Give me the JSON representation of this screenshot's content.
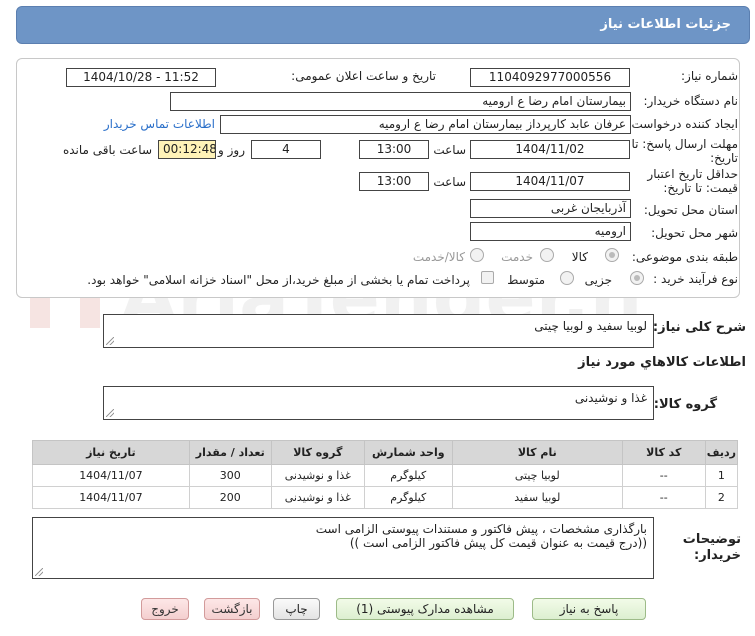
{
  "header": {
    "title": "جزئیات اطلاعات نیاز"
  },
  "form": {
    "need_number_label": "شماره نیاز:",
    "need_number": "1104092977000556",
    "announce_label": "تاریخ و ساعت اعلان عمومی:",
    "announce_value": "1404/10/28 - 11:52",
    "buyer_org_label": "نام دستگاه خریدار:",
    "buyer_org": "بیمارستان امام رضا  ع  ارومیه",
    "requester_label": "ایجاد کننده درخواست:",
    "requester": "عرفان عابد کارپرداز بیمارستان امام رضا  ع  ارومیه",
    "contact_link": "اطلاعات تماس خریدار",
    "deadline_label_1": "مهلت ارسال پاسخ: تا",
    "deadline_label_2": "تاریخ:",
    "deadline_date": "1404/11/02",
    "time_label": "ساعت",
    "deadline_time": "13:00",
    "days_value": "4",
    "days_label": "روز و",
    "remaining_value": "00:12:48",
    "remaining_label": "ساعت باقی مانده",
    "validity_label_1": "حداقل تاریخ اعتبار",
    "validity_label_2": "قیمت: تا تاریخ:",
    "validity_date": "1404/11/07",
    "validity_time": "13:00",
    "province_label": "استان محل تحویل:",
    "province": "آذربایجان غربی",
    "city_label": "شهر محل تحویل:",
    "city": "ارومیه",
    "category_label": "طبقه بندی موضوعی:",
    "category_options": [
      "کالا",
      "خدمت",
      "کالا/خدمت"
    ],
    "process_label": "نوع فرآیند خرید :",
    "process_options": [
      "جزیی",
      "متوسط"
    ],
    "payment_note": "پرداخت تمام یا بخشی از مبلغ خرید،از محل \"اسناد خزانه اسلامی\" خواهد بود."
  },
  "summary": {
    "label": "شرح کلی نیاز:",
    "value": "لوبیا سفید و لوبیا چیتی"
  },
  "goods_info_title": "اطلاعات کالاهاي مورد نیاز",
  "goods_group": {
    "label": "گروه کالا:",
    "value": "غذا و نوشیدنی"
  },
  "table": {
    "headers": [
      "ردیف",
      "کد کالا",
      "نام کالا",
      "واحد شمارش",
      "گروه کالا",
      "تعداد / مقدار",
      "تاریخ نیاز"
    ],
    "rows": [
      [
        "1",
        "--",
        "لوبیا چیتی",
        "کیلوگرم",
        "غذا و نوشیدنی",
        "300",
        "1404/11/07"
      ],
      [
        "2",
        "--",
        "لوبیا سفید",
        "کیلوگرم",
        "غذا و نوشیدنی",
        "200",
        "1404/11/07"
      ]
    ]
  },
  "buyer_notes": {
    "label_1": "توضیحات",
    "label_2": "خریدار:",
    "line_1": "بارگذاری مشخصات ، پیش فاکتور و مستندات پیوستی الزامی است",
    "line_2": "((درج قیمت به عنوان قیمت کل پیش فاکتور الزامی است ))"
  },
  "buttons": {
    "reply": "پاسخ به نیاز",
    "attachments": "مشاهده مدارک پیوستی (1)",
    "print": "چاپ",
    "back": "بازگشت",
    "exit": "خروج"
  },
  "watermark": "AriaTender.net",
  "colors": {
    "header_bg": "#6e95c6",
    "link": "#2a6fc9",
    "remaining_bg": "#fff3b8"
  }
}
